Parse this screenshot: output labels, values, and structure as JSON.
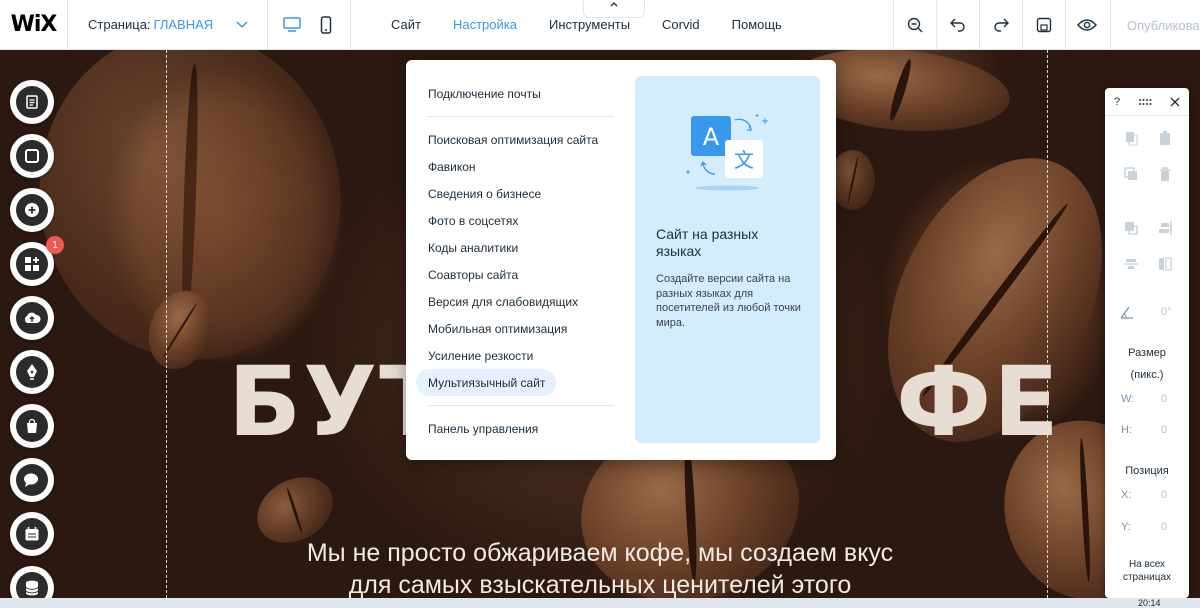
{
  "topbar": {
    "logo": "WiX",
    "page_prefix": "Страница:",
    "page_name": "ГЛАВНАЯ",
    "menu": [
      {
        "label": "Сайт",
        "active": false
      },
      {
        "label": "Настройка",
        "active": true
      },
      {
        "label": "Инструменты",
        "active": false
      },
      {
        "label": "Corvid",
        "active": false
      },
      {
        "label": "Помощь",
        "active": false
      }
    ],
    "tools": [
      "zoom-icon",
      "undo-icon",
      "redo-icon",
      "save-icon",
      "preview-icon"
    ],
    "publish": "Опубликовать"
  },
  "left_toolbar": {
    "items": [
      "pages-icon",
      "background-icon",
      "add-icon",
      "apps-icon",
      "upload-icon",
      "blog-icon",
      "store-icon",
      "chat-icon",
      "bookings-icon",
      "database-icon"
    ],
    "apps_badge": "1"
  },
  "canvas": {
    "headline_left": "БУТ",
    "headline_right": "ФЕ",
    "subtitle_line1": "Мы не просто обжариваем кофе, мы создаем вкус",
    "subtitle_line2": "для самых взыскательных ценителей этого"
  },
  "dropdown": {
    "group1": [
      "Подключение почты"
    ],
    "group2": [
      "Поисковая оптимизация сайта",
      "Фавикон",
      "Сведения о бизнесе",
      "Фото в соцсетях",
      "Коды аналитики",
      "Соавторы сайта",
      "Версия для слабовидящих",
      "Мобильная оптимизация",
      "Усиление резкости",
      "Мультиязычный сайт"
    ],
    "group3": [
      "Панель управления"
    ],
    "highlighted": "Мультиязычный сайт",
    "card": {
      "title": "Сайт на разных языках",
      "text": "Создайте версии сайта на разных языках для посетителей из любой точки мира.",
      "glyph_a": "A",
      "glyph_b": "文"
    }
  },
  "right_panel": {
    "help": "?",
    "size_label_1": "Размер",
    "size_label_2": "(пикс.)",
    "w_label": "W:",
    "w_value": "0",
    "h_label": "H:",
    "h_value": "0",
    "pos_label": "Позиция",
    "x_label": "X:",
    "x_value": "0",
    "y_label": "Y:",
    "y_value": "0",
    "angle": "0°",
    "all_pages_1": "На всех",
    "all_pages_2": "страницах"
  },
  "taskbar": {
    "clock": "20:14"
  },
  "colors": {
    "accent": "#3899ec",
    "card_bg": "#d3edff",
    "highlight": "#e7f0ff"
  }
}
